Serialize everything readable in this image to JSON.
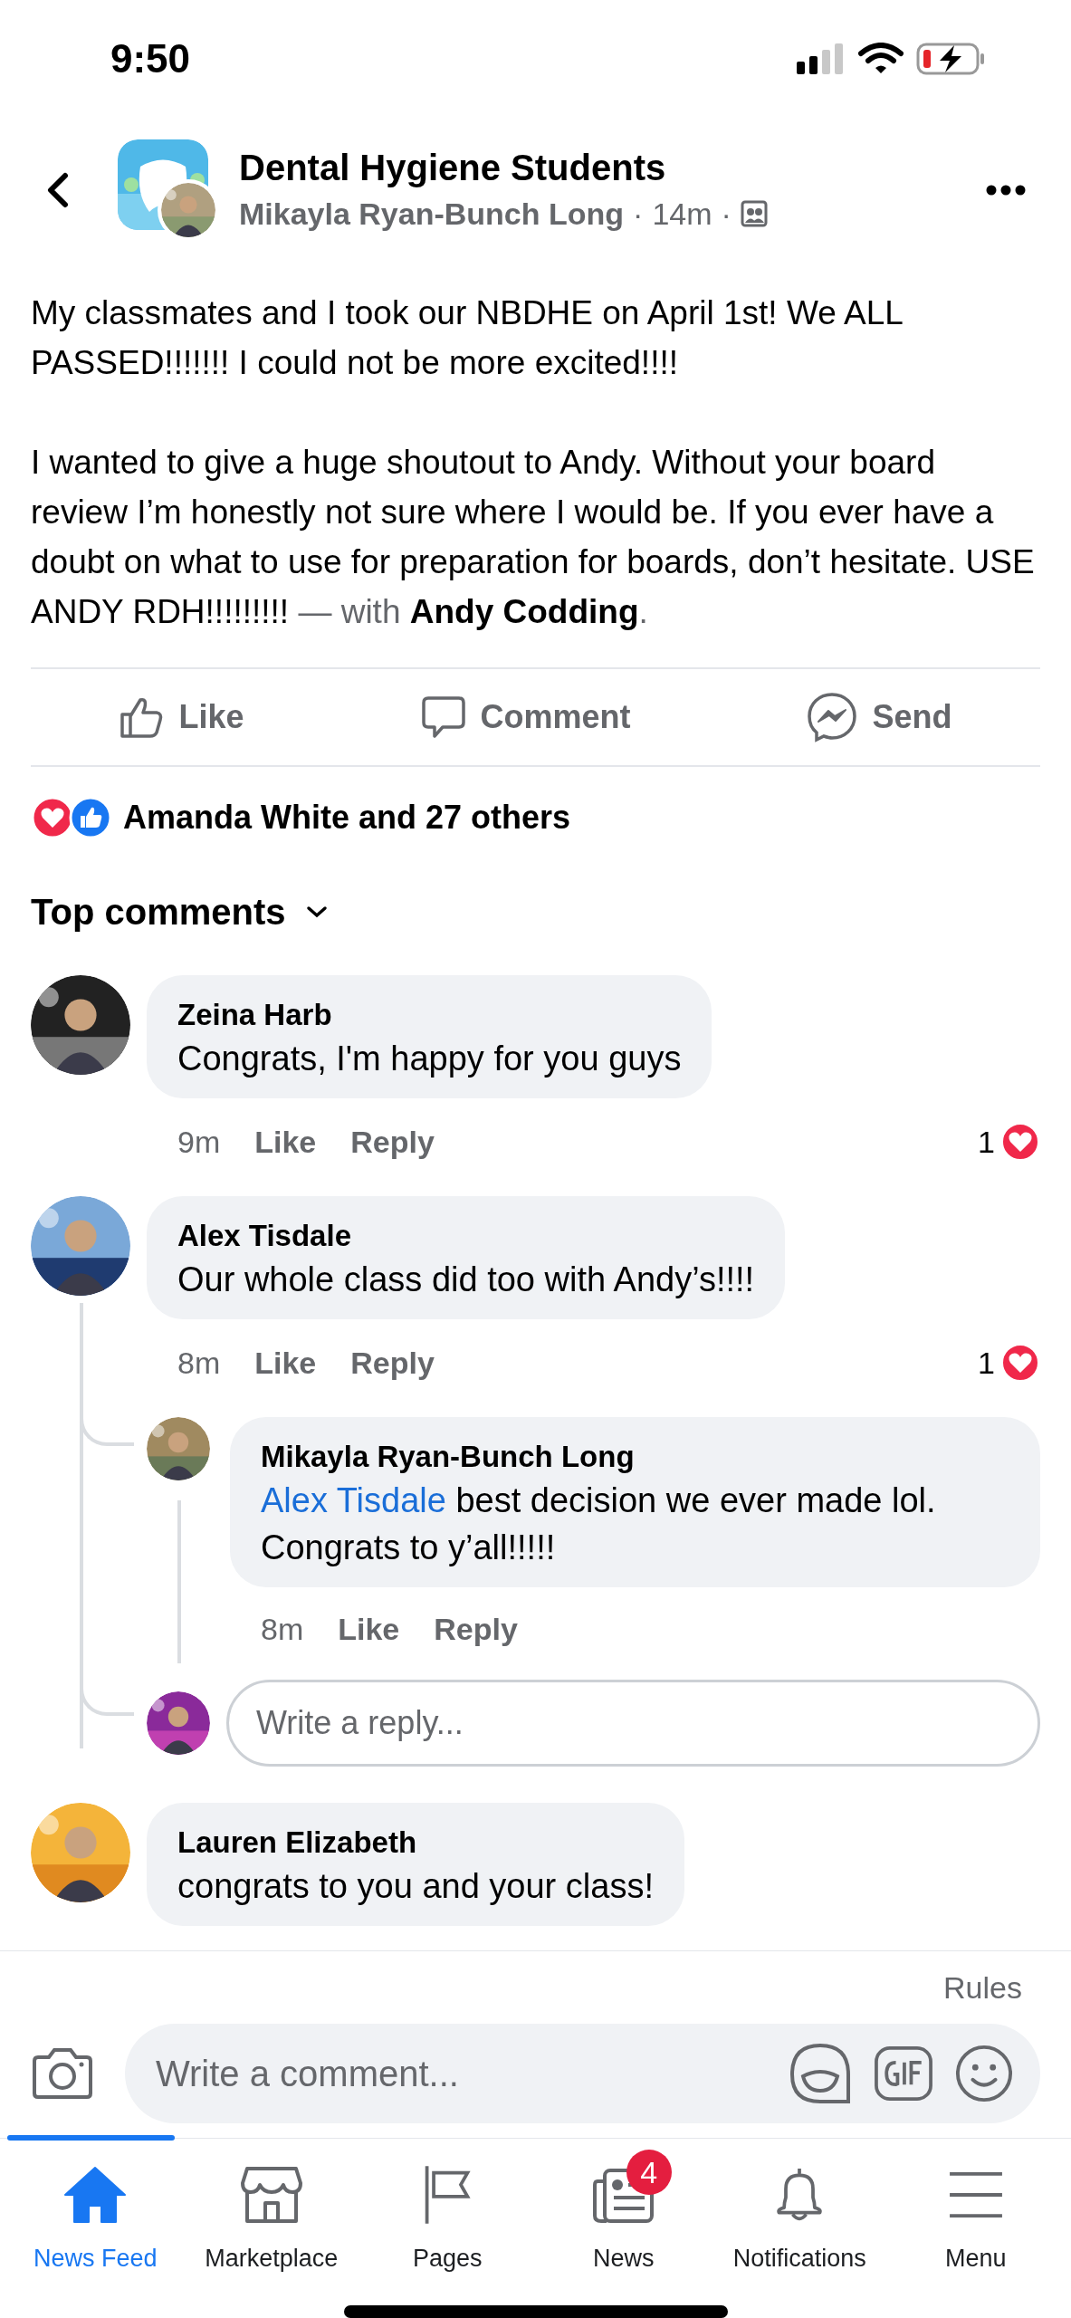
{
  "status_bar": {
    "time": "9:50"
  },
  "header": {
    "group": "Dental Hygiene Students",
    "author": "Mikayla Ryan-Bunch Long",
    "separator": "·",
    "time": "14m",
    "separator_2": "·"
  },
  "post": {
    "paragraphs": [
      "My classmates and I took our NBDHE on April 1st! We ALL PASSED!!!!!!! I could not be more excited!!!!",
      "I wanted to give a huge shoutout to Andy. Without your board review I’m honestly not sure where I would be. If you ever have a doubt on what to use for preparation for boards, don’t hesitate. USE ANDY RDH!!!!!!!!!"
    ],
    "with_label": "— with",
    "tagged": "Andy Codding",
    "end": "."
  },
  "actions": [
    {
      "kind": "like",
      "label": "Like"
    },
    {
      "kind": "comment",
      "label": "Comment"
    },
    {
      "kind": "send",
      "label": "Send"
    }
  ],
  "reactions": {
    "summary": "Amanda White and 27 others"
  },
  "sort_label": "Top comments",
  "comments": [
    {
      "author": "Zeina Harb",
      "text": "Congrats, I'm happy for you guys",
      "time": "9m",
      "like": "Like",
      "reply": "Reply",
      "reaction_count": "1"
    },
    {
      "author": "Alex Tisdale",
      "text": "Our whole class did too with Andy’s!!!!",
      "time": "8m",
      "like": "Like",
      "reply": "Reply",
      "reaction_count": "1",
      "replies": [
        {
          "author": "Mikayla Ryan-Bunch Long",
          "mention": "Alex Tisdale",
          "text": "best decision we ever made lol. Congrats to y’all!!!!!",
          "time": "8m",
          "like": "Like",
          "reply": "Reply"
        }
      ],
      "reply_field": {
        "placeholder": "Write a reply..."
      }
    },
    {
      "author": "Lauren Elizabeth",
      "text": "congrats to you and your class!"
    }
  ],
  "composer": {
    "rules": "Rules",
    "placeholder": "Write a comment..."
  },
  "tabs": [
    {
      "kind": "home",
      "label": "News Feed",
      "selected": true
    },
    {
      "kind": "store",
      "label": "Marketplace",
      "selected": false
    },
    {
      "kind": "flag",
      "label": "Pages",
      "selected": false
    },
    {
      "kind": "news",
      "label": "News",
      "selected": false,
      "badge": "4"
    },
    {
      "kind": "bell",
      "label": "Notifications",
      "selected": false
    },
    {
      "kind": "menu",
      "label": "Menu",
      "selected": false
    }
  ]
}
